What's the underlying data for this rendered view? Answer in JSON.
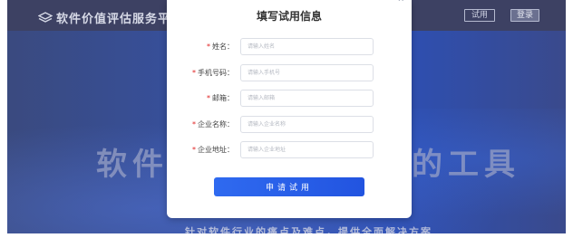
{
  "header": {
    "logo_text": "软件价值评估服务平台",
    "trial_label": "试用",
    "login_label": "登录"
  },
  "hero": {
    "title_left": "软件开",
    "title_right": "的工具",
    "subtitle": "针对软件行业的痛点及难点，提供全面解决方案"
  },
  "modal": {
    "title": "填写试用信息",
    "close_glyph": "^",
    "submit_label": "申请试用",
    "fields": [
      {
        "label": "姓名：",
        "placeholder": "请输入姓名"
      },
      {
        "label": "手机号码：",
        "placeholder": "请输入手机号"
      },
      {
        "label": "邮箱：",
        "placeholder": "请输入邮箱"
      },
      {
        "label": "企业名称：",
        "placeholder": "请输入企业名称"
      },
      {
        "label": "企业地址：",
        "placeholder": "请输入企业地址"
      }
    ],
    "required_mark": "*"
  },
  "colors": {
    "accent": "#2f6af0",
    "required": "#e02020"
  }
}
